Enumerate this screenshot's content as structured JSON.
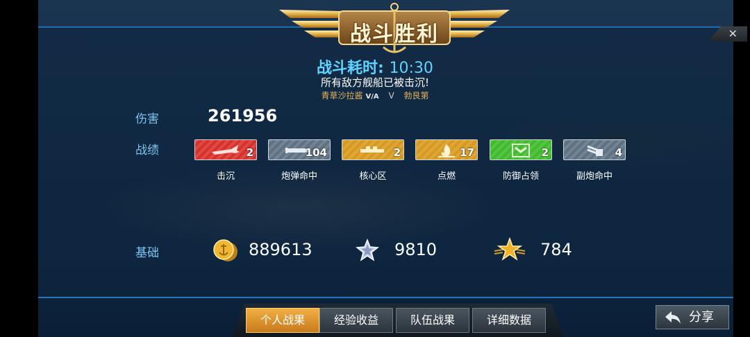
{
  "banner": {
    "title": "战斗胜利"
  },
  "close": {
    "label": "✕"
  },
  "summary": {
    "time_label": "战斗耗时:",
    "time_value": "10:30",
    "message": "所有敌方舰船已被击沉!",
    "player_left": "青草沙拉酱",
    "player_left_tag": "V/A",
    "vs": "V",
    "player_right": "勃艮第"
  },
  "damage": {
    "label": "伤害",
    "value": "261956"
  },
  "record": {
    "label": "战绩",
    "badges": [
      {
        "caption": "击沉",
        "count": "2",
        "color": "#d8312b",
        "icon": "plane-icon"
      },
      {
        "caption": "炮弹命中",
        "count": "104",
        "color": "#5f7284",
        "icon": "shell-icon"
      },
      {
        "caption": "核心区",
        "count": "2",
        "color": "#d79a1f",
        "icon": "citadel-icon"
      },
      {
        "caption": "点燃",
        "count": "17",
        "color": "#d79a1f",
        "icon": "fire-icon"
      },
      {
        "caption": "防御占领",
        "count": "2",
        "color": "#3fbb2b",
        "icon": "chevron-rank-icon"
      },
      {
        "caption": "副炮命中",
        "count": "4",
        "color": "#5f7284",
        "icon": "secondary-gun-icon"
      }
    ]
  },
  "base": {
    "label": "基础",
    "coins": "889613",
    "silver_star": "9810",
    "gold_star": "784"
  },
  "tabs": [
    {
      "label": "个人战果",
      "active": true
    },
    {
      "label": "经验收益",
      "active": false
    },
    {
      "label": "队伍战果",
      "active": false
    },
    {
      "label": "详细数据",
      "active": false
    }
  ],
  "share": {
    "label": "分享"
  }
}
